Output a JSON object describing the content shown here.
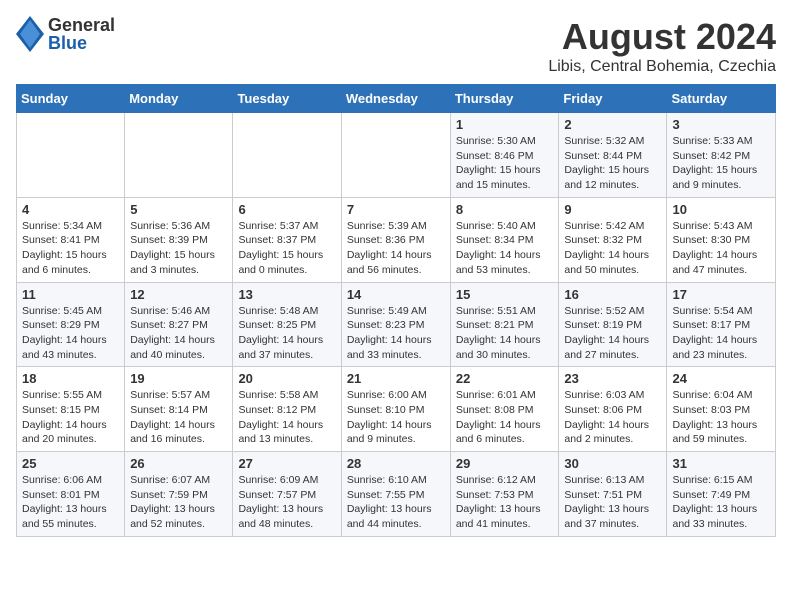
{
  "header": {
    "logo_general": "General",
    "logo_blue": "Blue",
    "month_year": "August 2024",
    "location": "Libis, Central Bohemia, Czechia"
  },
  "weekdays": [
    "Sunday",
    "Monday",
    "Tuesday",
    "Wednesday",
    "Thursday",
    "Friday",
    "Saturday"
  ],
  "weeks": [
    [
      {
        "day": "",
        "info": ""
      },
      {
        "day": "",
        "info": ""
      },
      {
        "day": "",
        "info": ""
      },
      {
        "day": "",
        "info": ""
      },
      {
        "day": "1",
        "info": "Sunrise: 5:30 AM\nSunset: 8:46 PM\nDaylight: 15 hours\nand 15 minutes."
      },
      {
        "day": "2",
        "info": "Sunrise: 5:32 AM\nSunset: 8:44 PM\nDaylight: 15 hours\nand 12 minutes."
      },
      {
        "day": "3",
        "info": "Sunrise: 5:33 AM\nSunset: 8:42 PM\nDaylight: 15 hours\nand 9 minutes."
      }
    ],
    [
      {
        "day": "4",
        "info": "Sunrise: 5:34 AM\nSunset: 8:41 PM\nDaylight: 15 hours\nand 6 minutes."
      },
      {
        "day": "5",
        "info": "Sunrise: 5:36 AM\nSunset: 8:39 PM\nDaylight: 15 hours\nand 3 minutes."
      },
      {
        "day": "6",
        "info": "Sunrise: 5:37 AM\nSunset: 8:37 PM\nDaylight: 15 hours\nand 0 minutes."
      },
      {
        "day": "7",
        "info": "Sunrise: 5:39 AM\nSunset: 8:36 PM\nDaylight: 14 hours\nand 56 minutes."
      },
      {
        "day": "8",
        "info": "Sunrise: 5:40 AM\nSunset: 8:34 PM\nDaylight: 14 hours\nand 53 minutes."
      },
      {
        "day": "9",
        "info": "Sunrise: 5:42 AM\nSunset: 8:32 PM\nDaylight: 14 hours\nand 50 minutes."
      },
      {
        "day": "10",
        "info": "Sunrise: 5:43 AM\nSunset: 8:30 PM\nDaylight: 14 hours\nand 47 minutes."
      }
    ],
    [
      {
        "day": "11",
        "info": "Sunrise: 5:45 AM\nSunset: 8:29 PM\nDaylight: 14 hours\nand 43 minutes."
      },
      {
        "day": "12",
        "info": "Sunrise: 5:46 AM\nSunset: 8:27 PM\nDaylight: 14 hours\nand 40 minutes."
      },
      {
        "day": "13",
        "info": "Sunrise: 5:48 AM\nSunset: 8:25 PM\nDaylight: 14 hours\nand 37 minutes."
      },
      {
        "day": "14",
        "info": "Sunrise: 5:49 AM\nSunset: 8:23 PM\nDaylight: 14 hours\nand 33 minutes."
      },
      {
        "day": "15",
        "info": "Sunrise: 5:51 AM\nSunset: 8:21 PM\nDaylight: 14 hours\nand 30 minutes."
      },
      {
        "day": "16",
        "info": "Sunrise: 5:52 AM\nSunset: 8:19 PM\nDaylight: 14 hours\nand 27 minutes."
      },
      {
        "day": "17",
        "info": "Sunrise: 5:54 AM\nSunset: 8:17 PM\nDaylight: 14 hours\nand 23 minutes."
      }
    ],
    [
      {
        "day": "18",
        "info": "Sunrise: 5:55 AM\nSunset: 8:15 PM\nDaylight: 14 hours\nand 20 minutes."
      },
      {
        "day": "19",
        "info": "Sunrise: 5:57 AM\nSunset: 8:14 PM\nDaylight: 14 hours\nand 16 minutes."
      },
      {
        "day": "20",
        "info": "Sunrise: 5:58 AM\nSunset: 8:12 PM\nDaylight: 14 hours\nand 13 minutes."
      },
      {
        "day": "21",
        "info": "Sunrise: 6:00 AM\nSunset: 8:10 PM\nDaylight: 14 hours\nand 9 minutes."
      },
      {
        "day": "22",
        "info": "Sunrise: 6:01 AM\nSunset: 8:08 PM\nDaylight: 14 hours\nand 6 minutes."
      },
      {
        "day": "23",
        "info": "Sunrise: 6:03 AM\nSunset: 8:06 PM\nDaylight: 14 hours\nand 2 minutes."
      },
      {
        "day": "24",
        "info": "Sunrise: 6:04 AM\nSunset: 8:03 PM\nDaylight: 13 hours\nand 59 minutes."
      }
    ],
    [
      {
        "day": "25",
        "info": "Sunrise: 6:06 AM\nSunset: 8:01 PM\nDaylight: 13 hours\nand 55 minutes."
      },
      {
        "day": "26",
        "info": "Sunrise: 6:07 AM\nSunset: 7:59 PM\nDaylight: 13 hours\nand 52 minutes."
      },
      {
        "day": "27",
        "info": "Sunrise: 6:09 AM\nSunset: 7:57 PM\nDaylight: 13 hours\nand 48 minutes."
      },
      {
        "day": "28",
        "info": "Sunrise: 6:10 AM\nSunset: 7:55 PM\nDaylight: 13 hours\nand 44 minutes."
      },
      {
        "day": "29",
        "info": "Sunrise: 6:12 AM\nSunset: 7:53 PM\nDaylight: 13 hours\nand 41 minutes."
      },
      {
        "day": "30",
        "info": "Sunrise: 6:13 AM\nSunset: 7:51 PM\nDaylight: 13 hours\nand 37 minutes."
      },
      {
        "day": "31",
        "info": "Sunrise: 6:15 AM\nSunset: 7:49 PM\nDaylight: 13 hours\nand 33 minutes."
      }
    ]
  ]
}
